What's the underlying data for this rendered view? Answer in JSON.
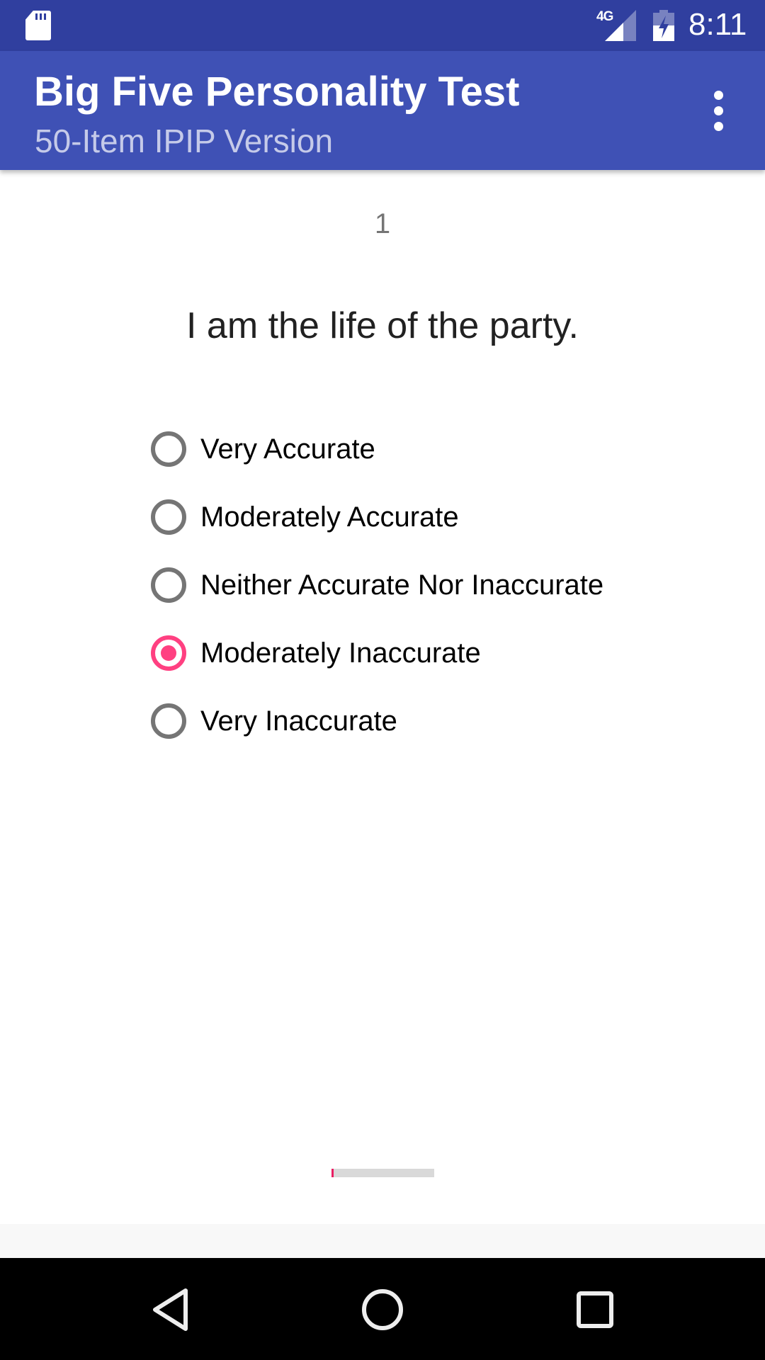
{
  "status_bar": {
    "network_label": "4G",
    "time": "8:11",
    "icons": [
      "sd-card-icon",
      "signal-icon",
      "battery-charging-icon"
    ]
  },
  "app_bar": {
    "title": "Big Five Personality Test",
    "subtitle": "50-Item IPIP Version",
    "menu_icon": "overflow-menu-icon"
  },
  "question": {
    "number": "1",
    "text": "I am the life of the party.",
    "options": [
      {
        "label": "Very Accurate",
        "selected": false
      },
      {
        "label": "Moderately Accurate",
        "selected": false
      },
      {
        "label": "Neither Accurate Nor Inaccurate",
        "selected": false
      },
      {
        "label": "Moderately Inaccurate",
        "selected": true
      },
      {
        "label": "Very Inaccurate",
        "selected": false
      }
    ]
  },
  "progress": {
    "current": 1,
    "total": 50,
    "fraction": 0.02
  },
  "colors": {
    "status_bar": "#303f9f",
    "primary": "#3f51b5",
    "accent": "#ff4081",
    "progress_fill": "#e91e63"
  },
  "nav_bar": {
    "buttons": [
      "back-icon",
      "home-icon",
      "recents-icon"
    ]
  }
}
